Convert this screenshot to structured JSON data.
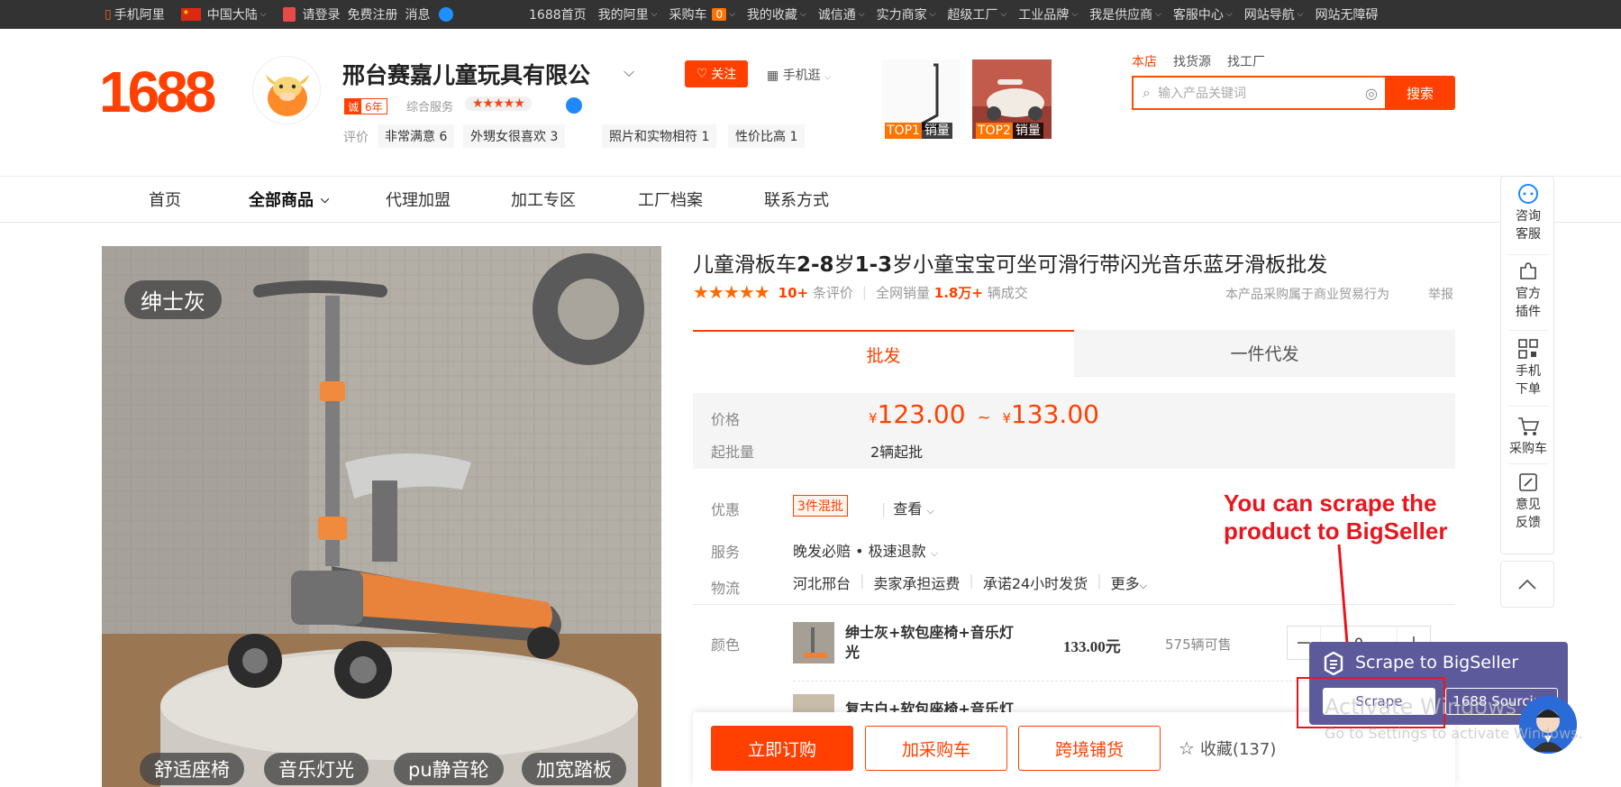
{
  "topbar": {
    "mobile_alibaba": "手机阿里",
    "region": "中国大陆",
    "login": "请登录",
    "register": "免费注册",
    "messages": "消息",
    "links": [
      {
        "label": "1688首页",
        "caret": false
      },
      {
        "label": "我的阿里",
        "caret": true
      },
      {
        "label": "采购车",
        "caret": true,
        "count": "0"
      },
      {
        "label": "我的收藏",
        "caret": true
      },
      {
        "label": "诚信通",
        "caret": true
      },
      {
        "label": "实力商家",
        "caret": true
      },
      {
        "label": "超级工厂",
        "caret": true
      },
      {
        "label": "工业品牌",
        "caret": true
      },
      {
        "label": "我是供应商",
        "caret": true
      },
      {
        "label": "客服中心",
        "caret": true
      },
      {
        "label": "网站导航",
        "caret": true
      },
      {
        "label": "网站无障碍",
        "caret": false
      }
    ]
  },
  "header": {
    "logo": "1688",
    "shop_name": "邢台赛嘉儿童玩具有限公",
    "follow_label": "关注",
    "mobile_browse": "手机逛",
    "cheng_badge_1": "诚",
    "cheng_badge_2": "6年",
    "service_label": "综合服务",
    "service_stars": "★★★★★",
    "review_label": "评价",
    "review_tags": [
      "非常满意 6",
      "外甥女很喜欢 3",
      "照片和实物相符 1",
      "性价比高 1"
    ],
    "top_products": [
      {
        "rank": "TOP1",
        "label": "销量"
      },
      {
        "rank": "TOP2",
        "label": "销量"
      }
    ],
    "search_tabs": [
      "本店",
      "找货源",
      "找工厂"
    ],
    "search_placeholder": "输入产品关键词",
    "search_button": "搜索"
  },
  "nav": {
    "items": [
      "首页",
      "全部商品",
      "代理加盟",
      "加工专区",
      "工厂档案",
      "联系方式"
    ]
  },
  "product": {
    "image_tags": [
      "绅士灰",
      "舒适座椅",
      "音乐灯光",
      "pu静音轮",
      "加宽踏板"
    ],
    "title_parts": [
      "儿童滑板车",
      "2-8",
      "岁",
      "1-3",
      "岁小童宝宝可坐可滑行带闪光音乐蓝牙滑板批发"
    ],
    "rating_stars": "★★★★★",
    "review_count": "10+",
    "review_suffix": "条评价",
    "sales_label": "全网销量",
    "sales_value": "1.8万+",
    "sales_suffix": "辆成交",
    "biz_note": "本产品采购属于商业贸易行为",
    "report": "举报",
    "tab_wholesale": "批发",
    "tab_dropship": "一件代发",
    "price_label": "价格",
    "currency": "¥",
    "price_low": "123.00",
    "price_sep": "~",
    "price_high": "133.00",
    "moq_label": "起批量",
    "moq_value": "2辆起批",
    "promo_label": "优惠",
    "promo_badge": "3件混批",
    "promo_view": "查看",
    "service_label": "服务",
    "service_value": "晚发必赔 • 极速退款",
    "logistics_label": "物流",
    "logistics_items": [
      "河北邢台",
      "卖家承担运费",
      "承诺24小时发货",
      "更多"
    ],
    "color_label": "颜色",
    "variants": [
      {
        "name": "绅士灰+软包座椅+音乐灯光",
        "price": "133.00元",
        "stock": "575辆可售",
        "qty": "0"
      },
      {
        "name": "复古白+软包座椅+音乐灯",
        "price": "",
        "stock": "",
        "qty": ""
      }
    ]
  },
  "actions": {
    "order": "立即订购",
    "add_cart": "加采购车",
    "cross_border": "跨境铺货",
    "favorite": "收藏(137)"
  },
  "sidebar": {
    "items": [
      {
        "line1": "咨询",
        "line2": "客服"
      },
      {
        "line1": "官方",
        "line2": "插件"
      },
      {
        "line1": "手机",
        "line2": "下单"
      },
      {
        "line1": "采购车",
        "line2": ""
      },
      {
        "line1": "意见",
        "line2": "反馈"
      }
    ]
  },
  "annotation": {
    "line1": "You can scrape the",
    "line2": "product to BigSeller"
  },
  "bigseller": {
    "title": "Scrape to BigSeller",
    "scrape": "Scrape",
    "sourcing": "1688 Sourcing"
  },
  "watermark": {
    "line1": "Activate Windows",
    "line2": "Go to Settings to activate Windows."
  },
  "colors": {
    "brand": "#ff4000",
    "topbar": "#333333",
    "bigseller": "#5d5a9c",
    "annotation": "#e8161f"
  }
}
